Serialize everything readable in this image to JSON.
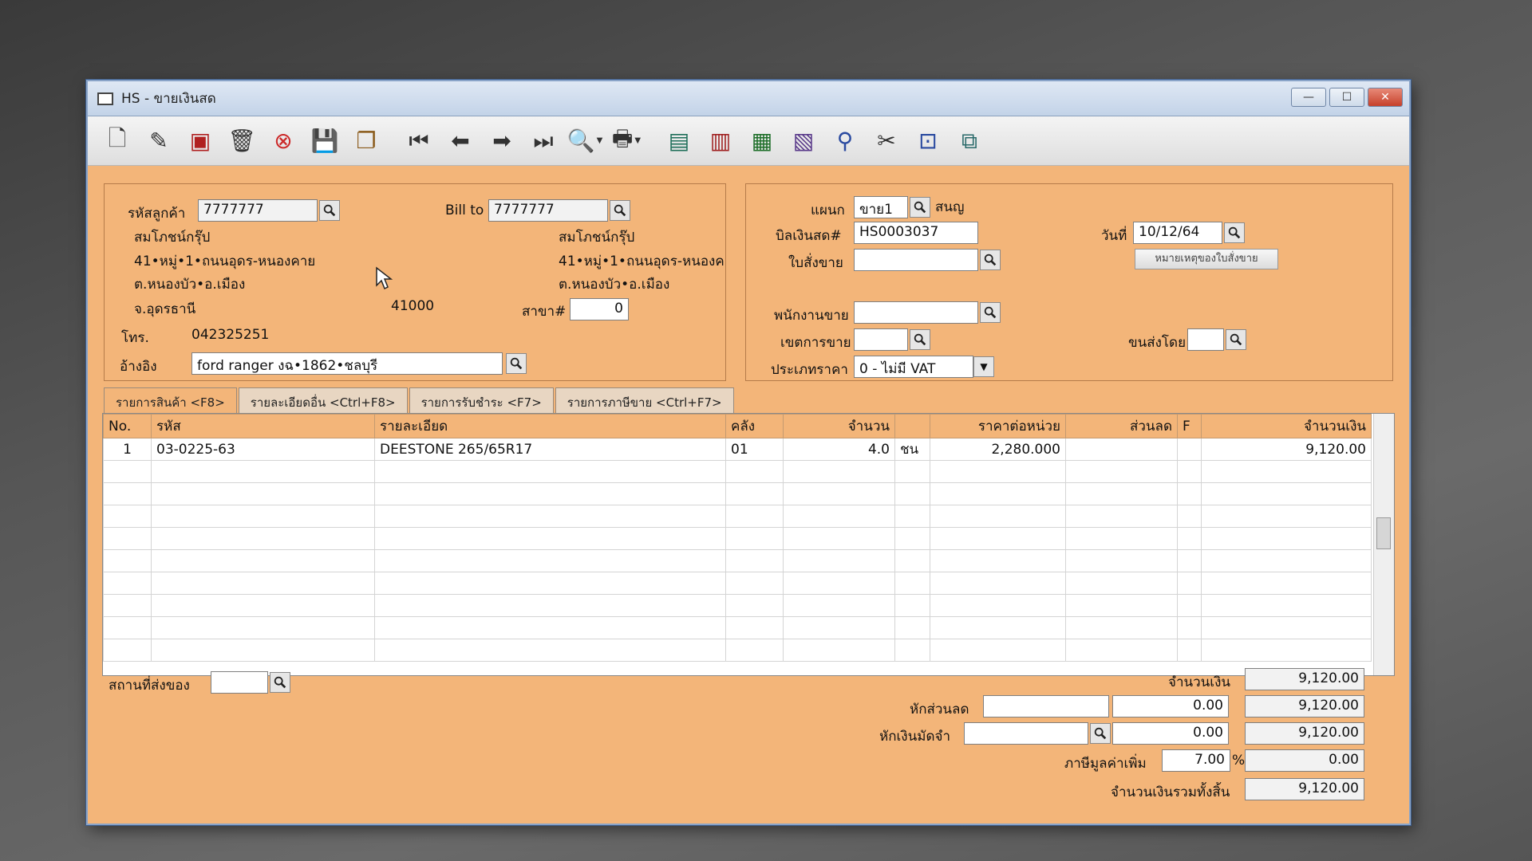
{
  "window": {
    "title": "HS - ขายเงินสด",
    "min": "—",
    "max": "☐",
    "close": "✕"
  },
  "toolbar": {
    "icons": [
      "new-doc-icon",
      "edit-icon",
      "void-icon",
      "delete-icon",
      "cancel-icon",
      "save-icon",
      "copy-icon",
      "first-icon",
      "prev-icon",
      "next-icon",
      "last-icon",
      "find-icon",
      "print-icon",
      "report1-icon",
      "report2-icon",
      "report3-icon",
      "calendar-icon",
      "approve-icon",
      "tools-icon",
      "ok-icon",
      "network-icon"
    ]
  },
  "customer": {
    "code_label": "รหัสลูกค้า",
    "code": "7777777",
    "billto_label": "Bill to",
    "billto": "7777777",
    "name": "สมโภชน์กรุ๊ป",
    "addr1": "41•หมู่•1•ถนนอุดร-หนองคาย",
    "addr2": "ต.หนองบัว•อ.เมือง",
    "province": "จ.อุดรธานี",
    "zip": "41000",
    "bill_name": "สมโภชน์กรุ๊ป",
    "bill_addr1": "41•หมู่•1•ถนนอุดร-หนองค",
    "bill_addr2": "ต.หนองบัว•อ.เมือง",
    "branch_label": "สาขา#",
    "branch": "0",
    "phone_label": "โทร.",
    "phone": "042325251",
    "ref_label": "อ้างอิง",
    "ref": "ford ranger งฉ•1862•ชลบุรี"
  },
  "doc": {
    "dept_label": "แผนก",
    "dept": "ขาย1",
    "dept_name": "สนญ",
    "bill_label": "บิลเงินสด#",
    "bill": "HS0003037",
    "date_label": "วันที่",
    "date": "10/12/64",
    "order_label": "ใบสั่งขาย",
    "order": "",
    "order_note_btn": "หมายเหตุของใบสั่งขาย",
    "sales_label": "พนักงานขาย",
    "sales": "",
    "area_label": "เขตการขาย",
    "area": "",
    "ship_label": "ขนส่งโดย",
    "ship": "",
    "price_label": "ประเภทราคา",
    "price": "0 - ไม่มี VAT"
  },
  "tabs": [
    "รายการสินค้า <F8>",
    "รายละเอียดอื่น <Ctrl+F8>",
    "รายการรับชำระ <F7>",
    "รายการภาษีขาย <Ctrl+F7>"
  ],
  "grid": {
    "headers": [
      "No.",
      "รหัส",
      "รายละเอียด",
      "คลัง",
      "จำนวน",
      "",
      "ราคาต่อหน่วย",
      "ส่วนลด",
      "F",
      "จำนวนเงิน"
    ],
    "rows": [
      [
        "1",
        "03-0225-63",
        "DEESTONE 265/65R17",
        "01",
        "4.0",
        "ชน",
        "2,280.000",
        "",
        "",
        "9,120.00"
      ]
    ]
  },
  "footer": {
    "delivery_label": "สถานที่ส่งของ",
    "delivery": "",
    "amount_label": "จำนวนเงิน",
    "amount": "9,120.00",
    "discount_label": "หักส่วนลด",
    "discount_text": "",
    "discount": "0.00",
    "after_discount": "9,120.00",
    "deposit_label": "หักเงินมัดจำ",
    "deposit_text": "",
    "deposit": "0.00",
    "after_deposit": "9,120.00",
    "vat_label": "ภาษีมูลค่าเพิ่ม",
    "vat_rate": "7.00",
    "vat_pct": "%",
    "vat": "0.00",
    "total_label": "จำนวนเงินรวมทั้งสิ้น",
    "total": "9,120.00"
  }
}
